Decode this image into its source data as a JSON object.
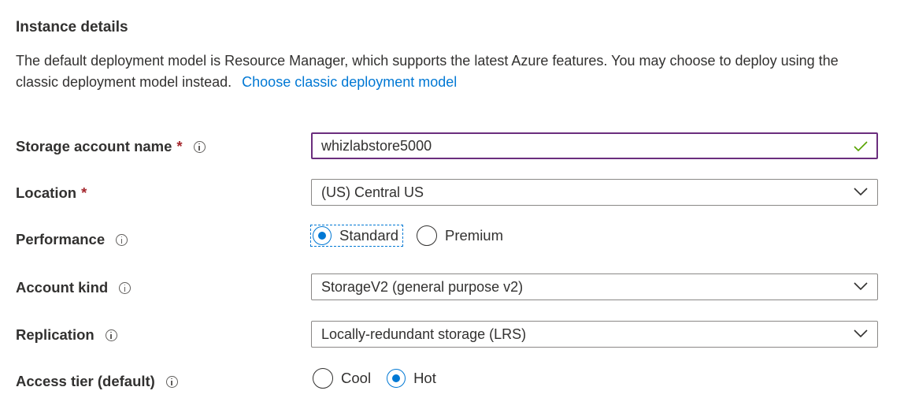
{
  "section": {
    "title": "Instance details",
    "description": "The default deployment model is Resource Manager, which supports the latest Azure features. You may choose to deploy using the classic deployment model instead.",
    "classic_link": "Choose classic deployment model"
  },
  "fields": {
    "storage_account_name": {
      "label": "Storage account name",
      "required_mark": "*",
      "value": "whizlabstore5000"
    },
    "location": {
      "label": "Location",
      "required_mark": "*",
      "value": "(US) Central US"
    },
    "performance": {
      "label": "Performance",
      "options": [
        "Standard",
        "Premium"
      ],
      "selected": "Standard"
    },
    "account_kind": {
      "label": "Account kind",
      "value": "StorageV2 (general purpose v2)"
    },
    "replication": {
      "label": "Replication",
      "value": "Locally-redundant storage (LRS)"
    },
    "access_tier": {
      "label": "Access tier (default)",
      "options": [
        "Cool",
        "Hot"
      ],
      "selected": "Hot"
    }
  },
  "colors": {
    "accent": "#0078d4",
    "required": "#a4262c",
    "focus_border": "#6b2e7e",
    "valid_check": "#57a300"
  },
  "icons": [
    "info-icon",
    "chevron-down-icon",
    "checkmark-icon"
  ]
}
